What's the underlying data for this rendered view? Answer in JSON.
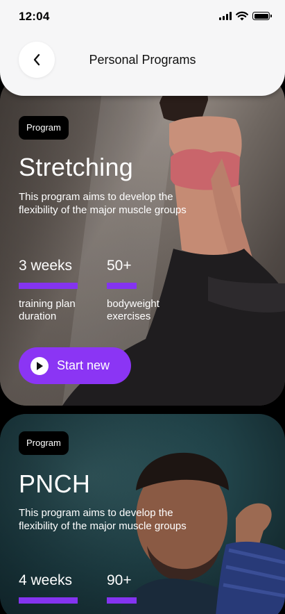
{
  "status_bar": {
    "time": "12:04",
    "icons": [
      "cellular-signal-icon",
      "wifi-icon",
      "battery-icon"
    ]
  },
  "header": {
    "title": "Personal Programs",
    "back_icon": "chevron-left-icon"
  },
  "programs": [
    {
      "badge": "Program",
      "title": "Stretching",
      "description": "This program aims to develop the flexibility of the major muscle groups",
      "stats": [
        {
          "value": "3 weeks",
          "label": "training plan duration"
        },
        {
          "value": "50+",
          "label": "bodyweight exercises"
        }
      ],
      "cta": {
        "label": "Start new",
        "icon": "play-icon"
      }
    },
    {
      "badge": "Program",
      "title": "PNCH",
      "description": "This program aims to develop the flexibility of the major muscle groups",
      "stats": [
        {
          "value": "4 weeks"
        },
        {
          "value": "90+"
        }
      ]
    }
  ],
  "colors": {
    "accent": "#8b35f4",
    "bar": "#8434f0",
    "header_bg": "#f6f6f7",
    "badge_bg": "#000000"
  }
}
